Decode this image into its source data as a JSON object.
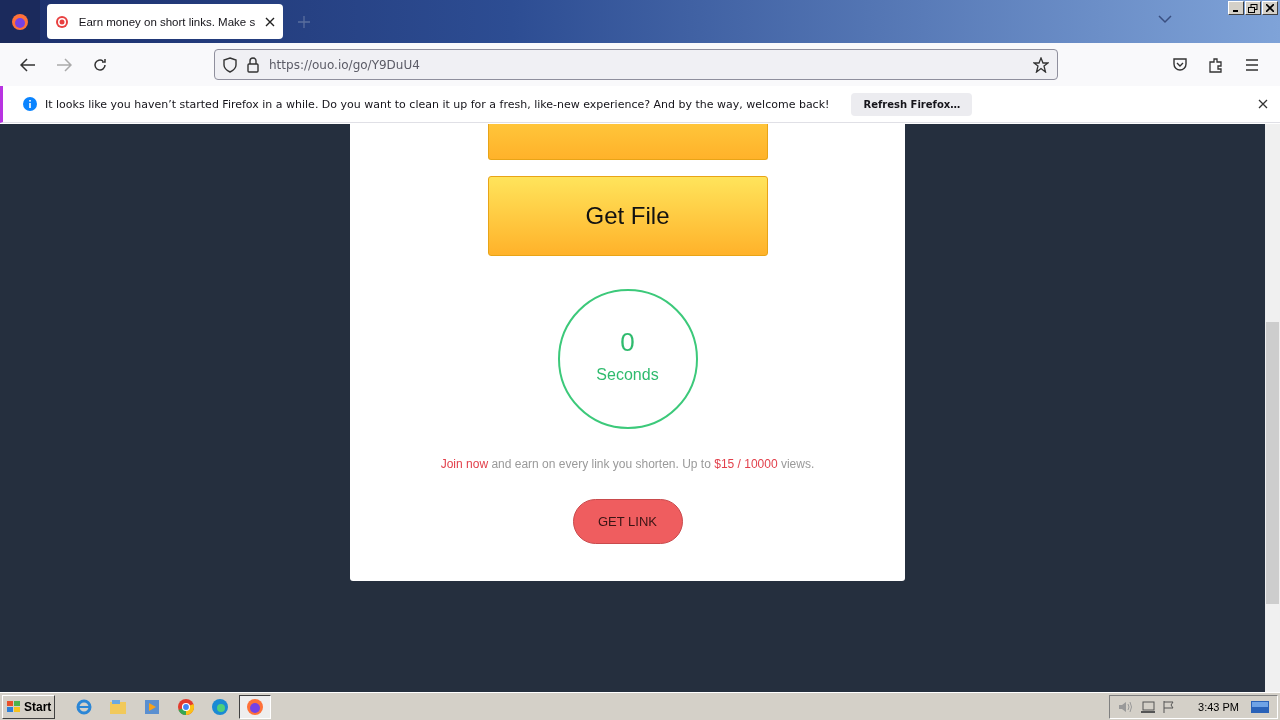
{
  "tabs": [
    {
      "title": "Earn money on short links. Make s",
      "selected": true
    }
  ],
  "address_bar": {
    "value": "https://ouo.io/go/Y9DuU4"
  },
  "notification": {
    "message": "It looks like you haven’t started Firefox in a while. Do you want to clean it up for a fresh, like-new experience? And by the way, welcome back!",
    "button": "Refresh Firefox…"
  },
  "page": {
    "buttons": [
      "Get File"
    ],
    "countdown": {
      "value": "0",
      "unit": "Seconds"
    },
    "promo": [
      {
        "text": "Join now",
        "kind": "link"
      },
      {
        "text": " and earn on every link you shorten. Up to ",
        "kind": "plain"
      },
      {
        "text": "$15 / 10000",
        "kind": "highlight"
      },
      {
        "text": " views.",
        "kind": "plain"
      }
    ],
    "get_link": "GET LINK"
  },
  "taskbar": {
    "start": "Start",
    "clock": "3:43 PM"
  }
}
